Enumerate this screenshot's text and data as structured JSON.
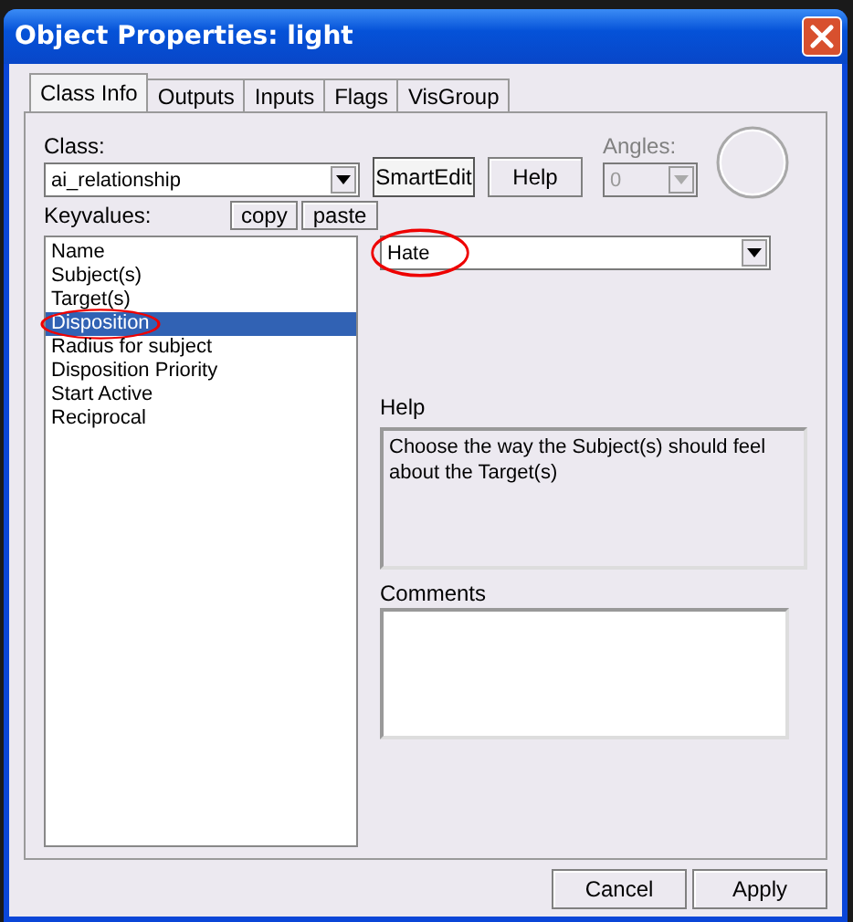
{
  "window": {
    "title": "Object Properties: light"
  },
  "tabs": [
    {
      "label": "Class Info",
      "selected": true
    },
    {
      "label": "Outputs",
      "selected": false
    },
    {
      "label": "Inputs",
      "selected": false
    },
    {
      "label": "Flags",
      "selected": false
    },
    {
      "label": "VisGroup",
      "selected": false
    }
  ],
  "class_label": "Class:",
  "class_combo": {
    "value": "ai_relationship"
  },
  "smartedit_button": {
    "label": "SmartEdit",
    "on": true
  },
  "help_button": "Help",
  "angles": {
    "label": "Angles:",
    "value": "0",
    "disabled": true
  },
  "keyvalues_label": "Keyvalues:",
  "copy_button": "copy",
  "paste_button": "paste",
  "keyvalues": [
    {
      "label": "Name",
      "selected": false,
      "circled": false
    },
    {
      "label": "Subject(s)",
      "selected": false,
      "circled": false
    },
    {
      "label": "Target(s)",
      "selected": false,
      "circled": false
    },
    {
      "label": "Disposition",
      "selected": true,
      "circled": true
    },
    {
      "label": "Radius for subject",
      "selected": false,
      "circled": false
    },
    {
      "label": "Disposition Priority",
      "selected": false,
      "circled": false
    },
    {
      "label": "Start Active",
      "selected": false,
      "circled": false
    },
    {
      "label": "Reciprocal",
      "selected": false,
      "circled": false
    }
  ],
  "value_combo": {
    "value": "Hate",
    "circled": true
  },
  "help": {
    "label": "Help",
    "text": "Choose the way the Subject(s) should feel about the Target(s)"
  },
  "comments": {
    "label": "Comments"
  },
  "buttons": [
    "Cancel",
    "Apply"
  ]
}
